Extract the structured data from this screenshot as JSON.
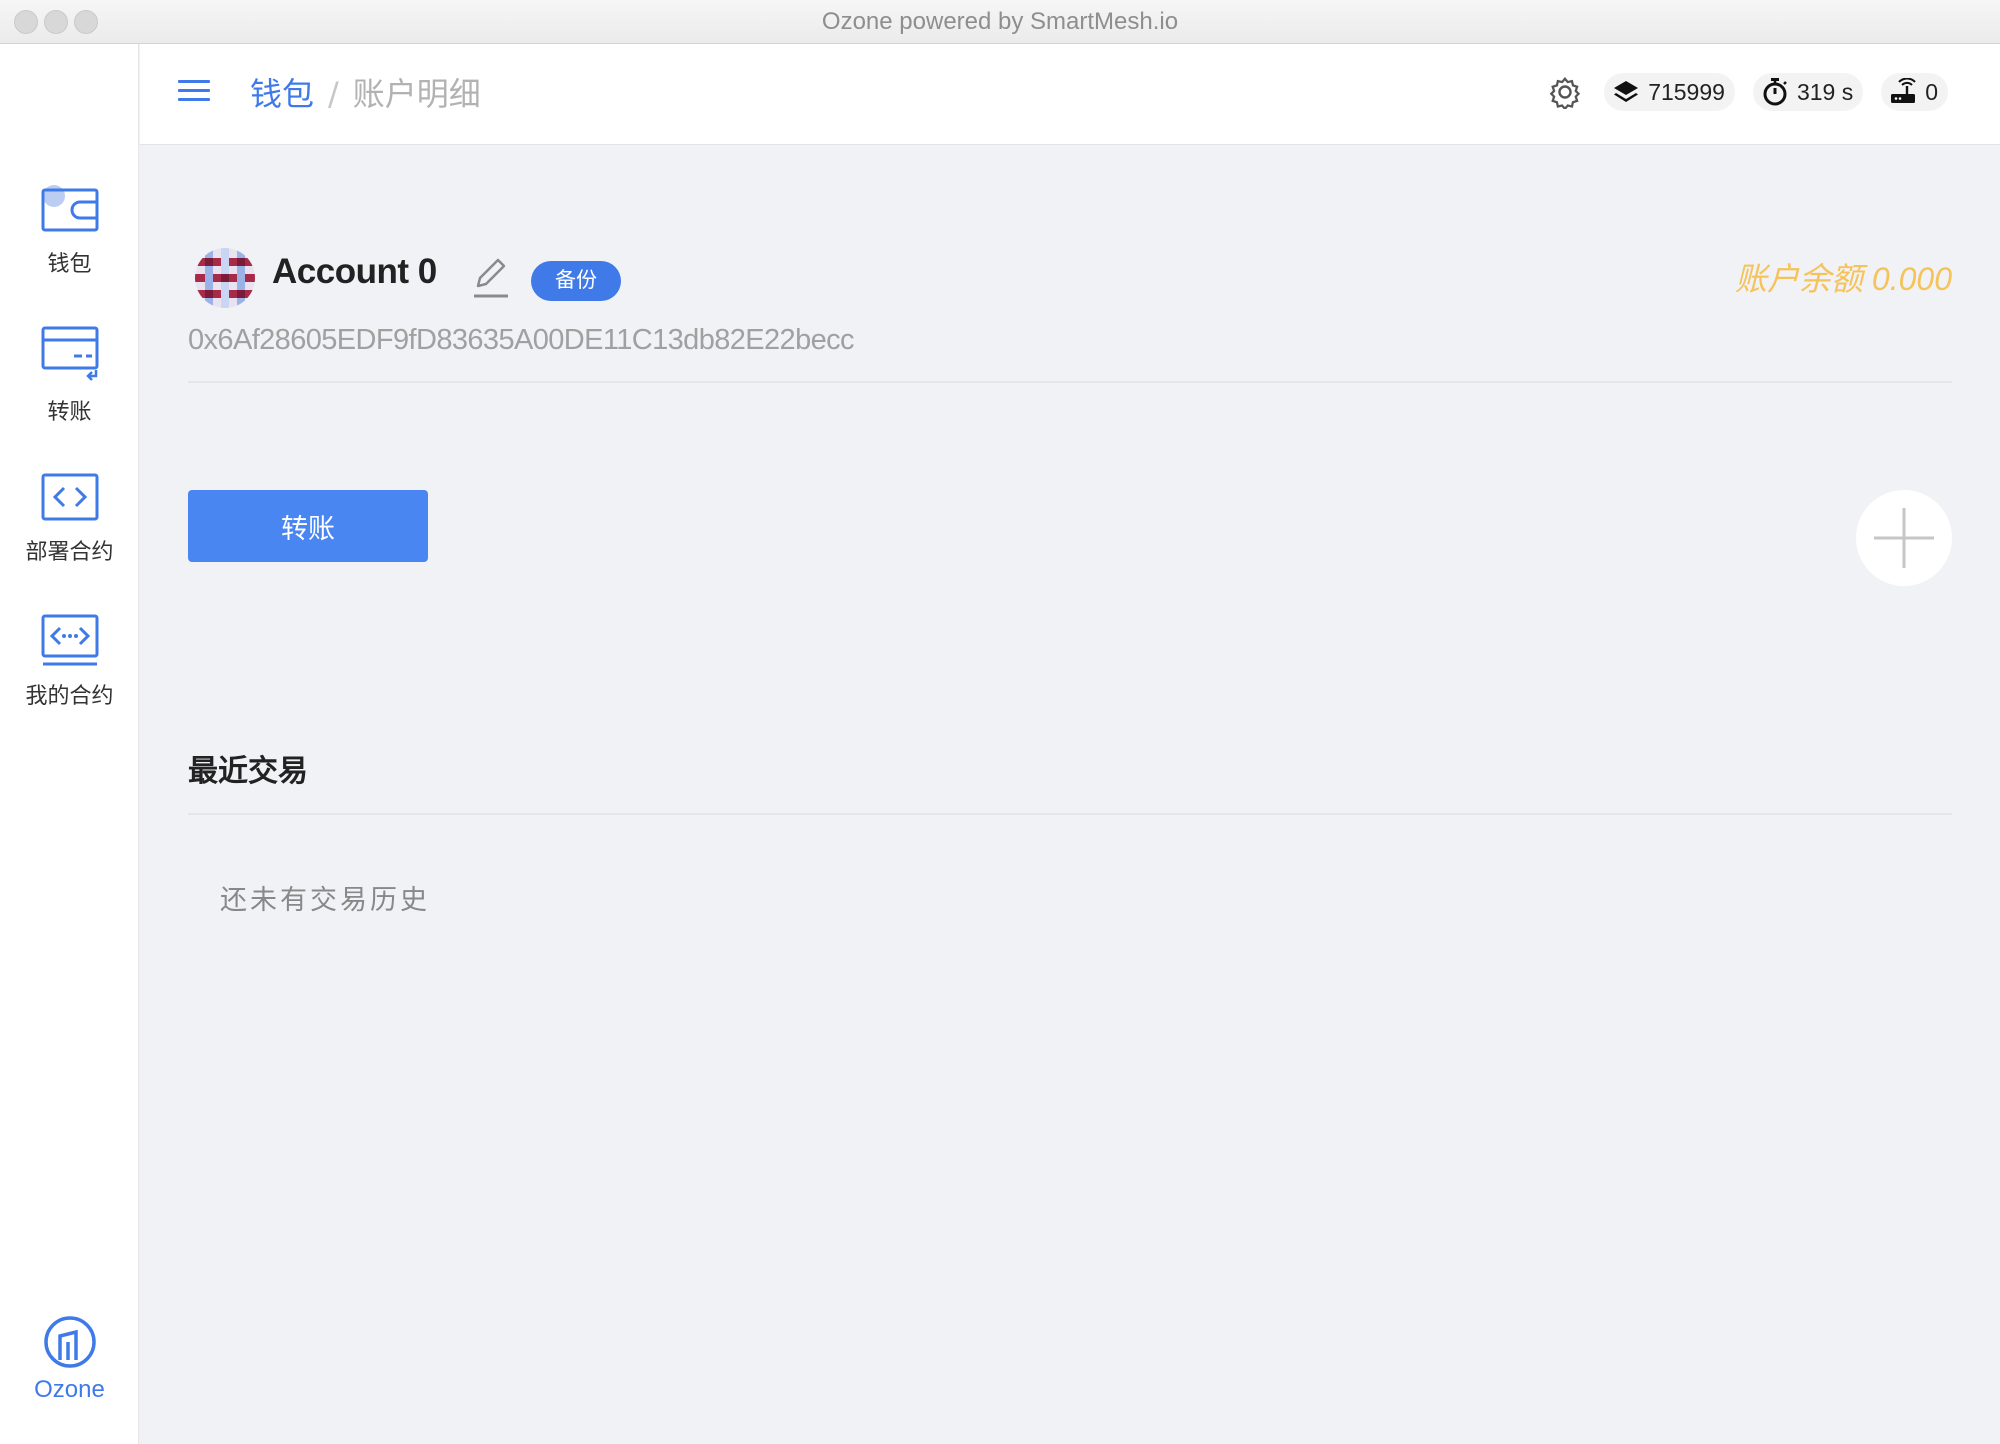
{
  "window": {
    "title": "Ozone powered by SmartMesh.io"
  },
  "sidebar": {
    "items": [
      {
        "id": "wallet",
        "label": "钱包",
        "icon": "wallet-icon"
      },
      {
        "id": "transfer",
        "label": "转账",
        "icon": "card-transfer-icon"
      },
      {
        "id": "deploy",
        "label": "部署合约",
        "icon": "code-icon"
      },
      {
        "id": "contracts",
        "label": "我的合约",
        "icon": "code-dots-icon"
      }
    ],
    "brand": {
      "label": "Ozone",
      "icon": "ozone-logo-icon"
    }
  },
  "header": {
    "breadcrumb": {
      "root": "钱包",
      "separator": "/",
      "current": "账户明细"
    },
    "status": {
      "block": "715999",
      "timer": "319 s",
      "peers": "0"
    }
  },
  "account": {
    "name": "Account 0",
    "backup_label": "备份",
    "balance": "账户余额 0.000",
    "address": "0x6Af28605EDF9fD83635A00DE11C13db82E22becc"
  },
  "actions": {
    "transfer_label": "转账"
  },
  "transactions": {
    "title": "最近交易",
    "empty": "还未有交易历史"
  },
  "colors": {
    "accent": "#3f7ae8",
    "balance": "#f5c35a",
    "background": "#f1f2f6"
  }
}
